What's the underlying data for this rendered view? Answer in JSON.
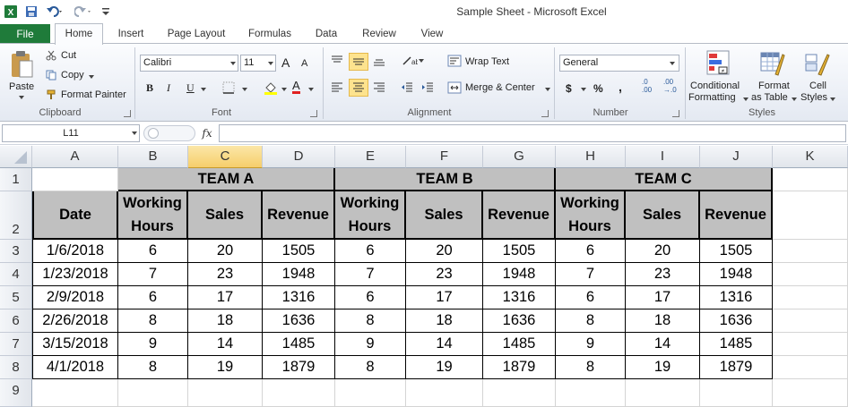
{
  "window": {
    "title": "Sample Sheet  -  Microsoft Excel"
  },
  "tabs": [
    "File",
    "Home",
    "Insert",
    "Page Layout",
    "Formulas",
    "Data",
    "Review",
    "View"
  ],
  "clipboard": {
    "paste": "Paste",
    "cut": "Cut",
    "copy": "Copy",
    "format_painter": "Format Painter",
    "label": "Clipboard"
  },
  "font": {
    "name": "Calibri",
    "size": "11",
    "label": "Font",
    "bold": "B",
    "italic": "I",
    "underline": "U",
    "grow": "A",
    "shrink": "A",
    "color": "A"
  },
  "alignment": {
    "wrap": "Wrap Text",
    "merge": "Merge & Center",
    "label": "Alignment"
  },
  "number": {
    "format": "General",
    "currency": "$",
    "percent": "%",
    "comma": ",",
    "inc_decimal": ".0\n.00",
    "dec_decimal": ".00\n→.0",
    "label": "Number"
  },
  "styles": {
    "conditional": "Conditional",
    "formatting": "Formatting",
    "format": "Format",
    "as_table": "as Table",
    "cell": "Cell",
    "cell_styles": "Styles",
    "label": "Styles"
  },
  "formula_bar": {
    "name_box": "L11",
    "fx": "fx",
    "value": ""
  },
  "columns": [
    "A",
    "B",
    "C",
    "D",
    "E",
    "F",
    "G",
    "H",
    "I",
    "J",
    "K"
  ],
  "selected_column": "C",
  "rows": [
    "1",
    "2",
    "3",
    "4",
    "5",
    "6",
    "7",
    "8",
    "9"
  ],
  "teams": [
    "TEAM A",
    "TEAM B",
    "TEAM C"
  ],
  "headers": {
    "date": "Date",
    "working_hours": [
      "Working",
      "Hours"
    ],
    "sales": "Sales",
    "revenue": "Revenue"
  },
  "table": [
    [
      "1/6/2018",
      "6",
      "20",
      "1505"
    ],
    [
      "1/23/2018",
      "7",
      "23",
      "1948"
    ],
    [
      "2/9/2018",
      "6",
      "17",
      "1316"
    ],
    [
      "2/26/2018",
      "8",
      "18",
      "1636"
    ],
    [
      "3/15/2018",
      "9",
      "14",
      "1485"
    ],
    [
      "4/1/2018",
      "8",
      "19",
      "1879"
    ]
  ],
  "colors": {
    "file_tab": "#1f7b3a",
    "header_fill": "#c0c0c0",
    "selected_col": "#f6ce6b"
  }
}
